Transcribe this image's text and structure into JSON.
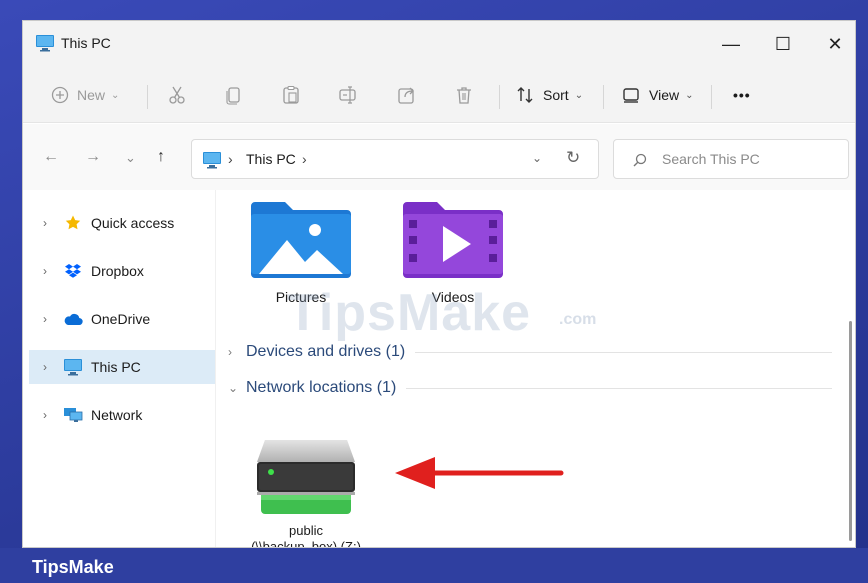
{
  "window": {
    "title": "This PC",
    "title_icon": "monitor-icon",
    "controls": {
      "minimize": "—",
      "maximize": "☐",
      "close": "✕"
    }
  },
  "commandbar": {
    "new_label": "New",
    "sort_label": "Sort",
    "view_label": "View",
    "more_label": "•••",
    "icons": [
      "plus-circle-icon",
      "cut-icon",
      "copy-icon",
      "paste-icon",
      "rename-icon",
      "share-icon",
      "delete-icon",
      "sort-icon",
      "view-icon"
    ]
  },
  "address": {
    "crumb_sep": "›",
    "crumb": "This PC",
    "trail_sep": "›",
    "dropdown": "⌄",
    "refresh": "↻"
  },
  "search": {
    "placeholder": "Search This PC"
  },
  "nav": {
    "back": "←",
    "forward": "→",
    "history": "⌄",
    "up": "↑"
  },
  "sidebar": {
    "items": [
      {
        "label": "Quick access",
        "icon": "star-icon",
        "arrow": "›"
      },
      {
        "label": "Dropbox",
        "icon": "dropbox-icon",
        "arrow": "›"
      },
      {
        "label": "OneDrive",
        "icon": "cloud-icon",
        "arrow": "›"
      },
      {
        "label": "This PC",
        "icon": "monitor-icon",
        "arrow": "›",
        "selected": true
      },
      {
        "label": "Network",
        "icon": "network-icon",
        "arrow": "›"
      }
    ]
  },
  "content": {
    "folders": [
      {
        "label": "Pictures",
        "icon": "pictures-folder-icon"
      },
      {
        "label": "Videos",
        "icon": "videos-folder-icon"
      }
    ],
    "groups": [
      {
        "chevron": "›",
        "title": "Devices and drives (1)"
      },
      {
        "chevron": "⌄",
        "title": "Network locations (1)"
      }
    ],
    "network_drive": {
      "label_line1": "public",
      "label_line2": "(\\\\backup_box) (Z:)",
      "icon": "network-drive-icon"
    }
  },
  "watermark": {
    "text": "TipsMake",
    "suffix": ".com"
  },
  "footer": {
    "brand": "TipsMake"
  },
  "colors": {
    "accent": "#0067c0",
    "selected_bg": "#dcebf7",
    "background": "#2f3fa0",
    "arrow_red": "#e0201e"
  }
}
